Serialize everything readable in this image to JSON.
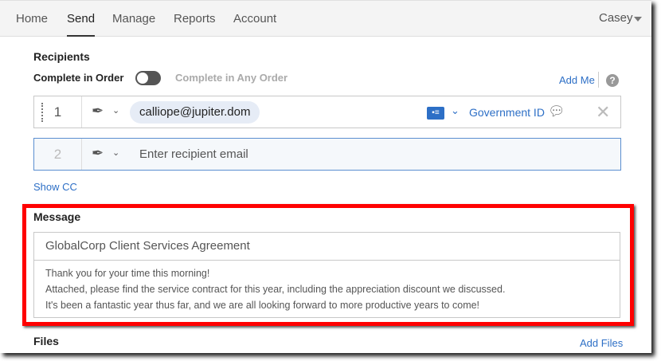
{
  "nav": {
    "tabs": [
      "Home",
      "Send",
      "Manage",
      "Reports",
      "Account"
    ],
    "active": "Send",
    "user": "Casey"
  },
  "recipients": {
    "title": "Recipients",
    "complete_in_order": "Complete in Order",
    "complete_any_order": "Complete in Any Order",
    "add_me": "Add Me",
    "help": "?",
    "rows": [
      {
        "number": "1",
        "email": "calliope@jupiter.dom",
        "auth": "Government ID"
      },
      {
        "number": "2",
        "placeholder": "Enter recipient email"
      }
    ],
    "show_cc": "Show CC"
  },
  "message": {
    "title": "Message",
    "subject": "GlobalCorp Client Services Agreement",
    "body": [
      "Thank you for your time this morning!",
      "Attached, please find the service contract for this year, including the appreciation discount we discussed.",
      "It's been a fantastic year thus far, and we are all looking forward to more productive years to come!"
    ]
  },
  "files": {
    "title": "Files",
    "add_files": "Add Files"
  },
  "colors": {
    "accent": "#2d6fc6",
    "highlight": "#ff0000"
  }
}
